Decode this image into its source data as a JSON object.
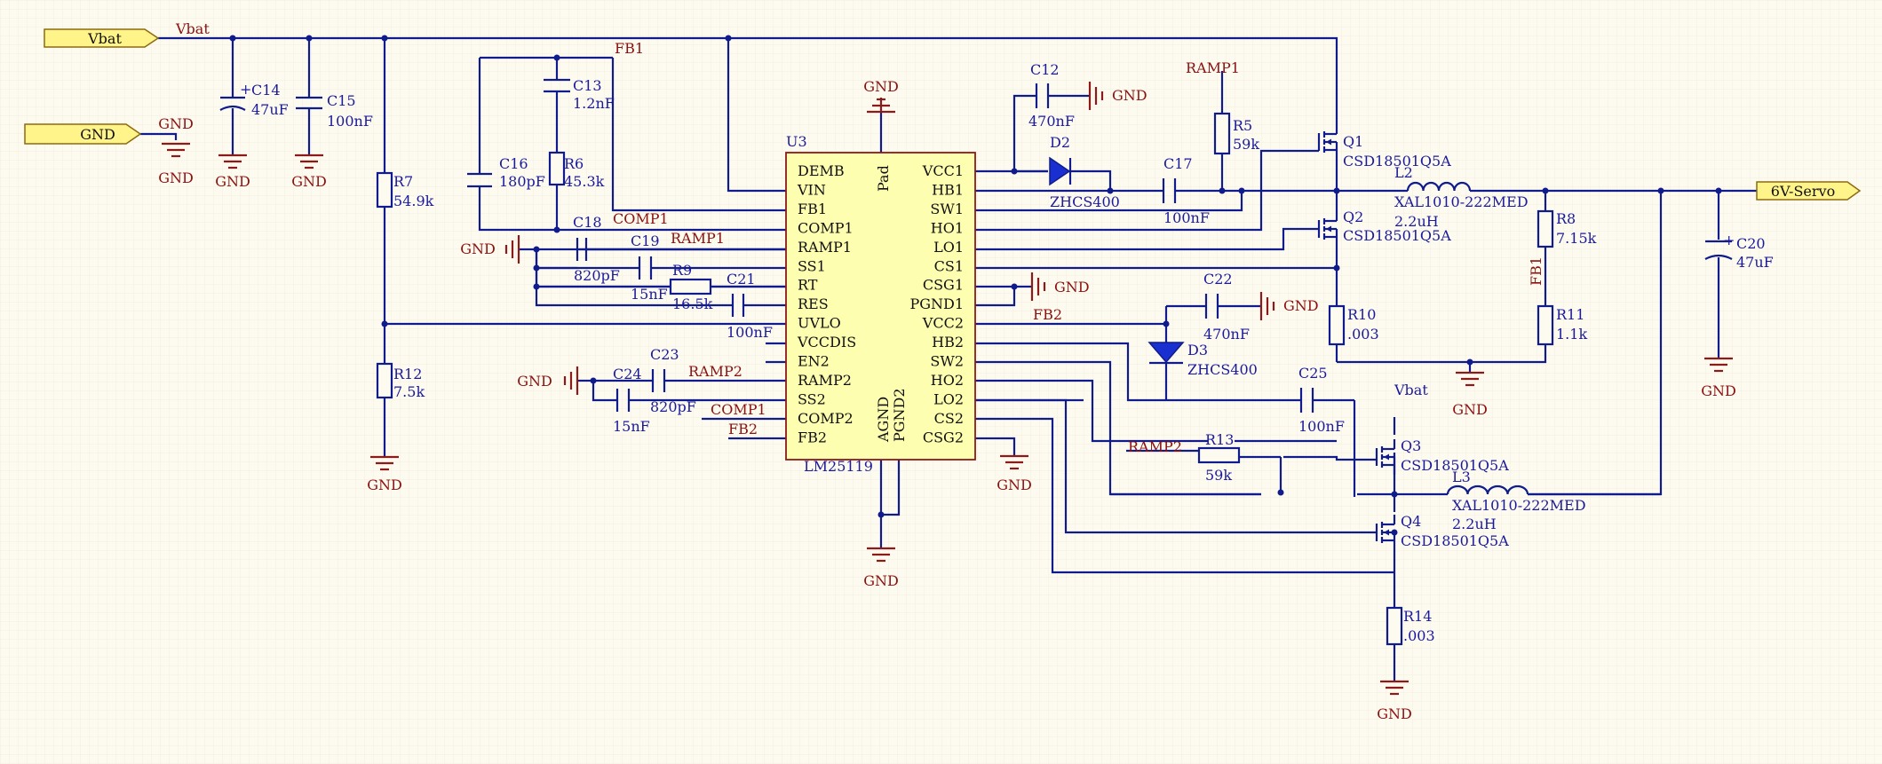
{
  "ports": {
    "vbat": "Vbat",
    "gnd": "GND",
    "out": "6V-Servo"
  },
  "nets": {
    "vbat": "Vbat",
    "fb1": "FB1",
    "fb2": "FB2",
    "comp1": "COMP1",
    "comp2": "COMP2",
    "ramp1": "RAMP1",
    "ramp2": "RAMP2",
    "gnd": "GND"
  },
  "ic": {
    "ref": "U3",
    "part": "LM25119",
    "left_pins": [
      "DEMB",
      "VIN",
      "FB1",
      "COMP1",
      "RAMP1",
      "SS1",
      "RT",
      "RES",
      "UVLO",
      "VCCDIS",
      "EN2",
      "RAMP2",
      "SS2",
      "COMP2",
      "FB2"
    ],
    "right_pins": [
      "VCC1",
      "HB1",
      "SW1",
      "HO1",
      "LO1",
      "CS1",
      "CSG1",
      "PGND1",
      "VCC2",
      "HB2",
      "SW2",
      "HO2",
      "LO2",
      "CS2",
      "CSG2"
    ],
    "pad": "Pad",
    "agnd": "AGND",
    "pgnd2": "PGND2"
  },
  "parts": {
    "C14": {
      "ref": "C14",
      "val": "47uF"
    },
    "C15": {
      "ref": "C15",
      "val": "100nF"
    },
    "R7": {
      "ref": "R7",
      "val": "54.9k"
    },
    "R12": {
      "ref": "R12",
      "val": "7.5k"
    },
    "C13": {
      "ref": "C13",
      "val": "1.2nF"
    },
    "C16": {
      "ref": "C16",
      "val": "180pF"
    },
    "R6": {
      "ref": "R6",
      "val": "45.3k"
    },
    "C18": {
      "ref": "C18",
      "val": "820pF"
    },
    "C19": {
      "ref": "C19",
      "val": "15nF"
    },
    "R9": {
      "ref": "R9",
      "val": "16.5k"
    },
    "C21": {
      "ref": "C21",
      "val": "100nF"
    },
    "C24": {
      "ref": "C24",
      "val": "15nF"
    },
    "C23": {
      "ref": "C23",
      "val": "820pF"
    },
    "C12": {
      "ref": "C12",
      "val": "470nF"
    },
    "D2": {
      "ref": "D2",
      "val": "ZHCS400"
    },
    "C17": {
      "ref": "C17",
      "val": "100nF"
    },
    "R5": {
      "ref": "R5",
      "val": "59k"
    },
    "Q1": {
      "ref": "Q1",
      "val": "CSD18501Q5A"
    },
    "Q2": {
      "ref": "Q2",
      "val": "CSD18501Q5A"
    },
    "L2": {
      "ref": "L2",
      "val": "XAL1010-222MED",
      "val2": "2.2uH"
    },
    "R10": {
      "ref": "R10",
      "val": ".003"
    },
    "R8": {
      "ref": "R8",
      "val": "7.15k"
    },
    "R11": {
      "ref": "R11",
      "val": "1.1k"
    },
    "C20": {
      "ref": "C20",
      "val": "47uF"
    },
    "C22": {
      "ref": "C22",
      "val": "470nF"
    },
    "D3": {
      "ref": "D3",
      "val": "ZHCS400"
    },
    "C25": {
      "ref": "C25",
      "val": "100nF"
    },
    "R13": {
      "ref": "R13",
      "val": "59k"
    },
    "Q3": {
      "ref": "Q3",
      "val": "CSD18501Q5A"
    },
    "Q4": {
      "ref": "Q4",
      "val": "CSD18501Q5A"
    },
    "L3": {
      "ref": "L3",
      "val": "XAL1010-222MED",
      "val2": "2.2uH"
    },
    "R14": {
      "ref": "R14",
      "val": ".003"
    }
  },
  "colors": {
    "wire": "#101c8c",
    "net_label": "#8b1010",
    "ic_fill": "#fefeb0",
    "port_fill": "#fff48a",
    "background": "#fdfbef"
  }
}
